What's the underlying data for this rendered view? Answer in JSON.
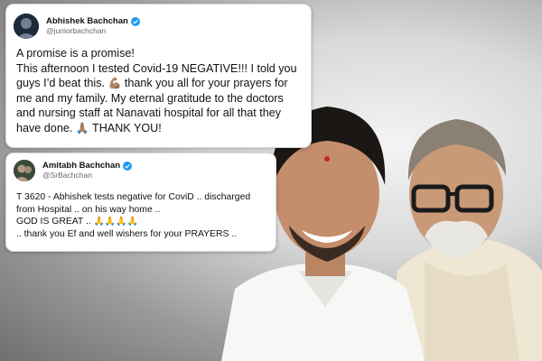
{
  "tweet1": {
    "name": "Abhishek Bachchan",
    "handle": "@juniorbachchan",
    "lines": [
      "A promise is a promise!",
      "This afternoon I tested Covid-19 NEGATIVE!!! I told you",
      "guys I’d beat this.",
      " thank you all for your prayers for",
      "me and my family. My eternal gratitude to the doctors",
      "and nursing staff at Nanavati hospital for all that they",
      "have done.",
      " THANK YOU!"
    ],
    "emoji_muscle": "💪🏽",
    "emoji_pray": "🙏🏽"
  },
  "tweet2": {
    "name": "Amitabh Bachchan",
    "handle": "@SrBachchan",
    "lines": [
      "T 3620 - Abhishek tests negative for CoviD .. discharged",
      "from Hospital .. on his way home ..",
      "GOD IS GREAT .. ",
      ".. thank you Ef and well wishers for your PRAYERS .."
    ],
    "emoji_pray4": "🙏🙏🙏🙏"
  },
  "icons": {
    "verified": "verified-badge-icon"
  },
  "colors": {
    "verified_blue": "#1d9bf0",
    "text": "#111111"
  }
}
